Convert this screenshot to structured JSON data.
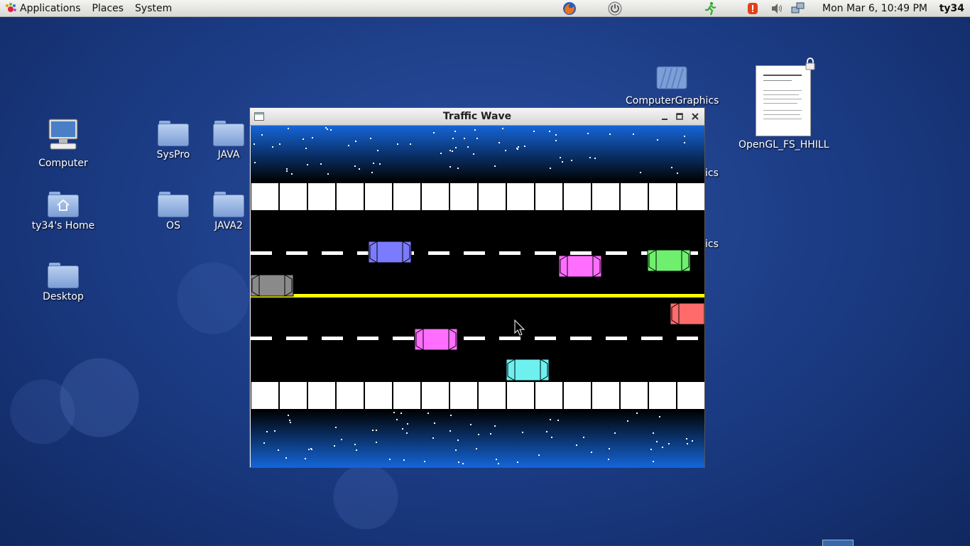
{
  "panel": {
    "menus": [
      "Applications",
      "Places",
      "System"
    ],
    "clock": "Mon Mar  6, 10:49 PM",
    "user": "ty34"
  },
  "desktop": {
    "icons": [
      "Computer",
      "SysPro",
      "JAVA",
      "ty34's Home",
      "OS",
      "JAVA2",
      "Desktop",
      "ComputerGraphics",
      "OpenGL_FS_HHILL"
    ],
    "partial_labels": [
      "ics",
      "ics"
    ]
  },
  "window": {
    "title": "Traffic Wave"
  },
  "icons": {
    "firefox": "firefox-icon",
    "power": "power-icon",
    "runner": "running-man-icon",
    "alert": "alert-icon",
    "volume": "volume-icon",
    "network": "network-icon"
  },
  "colors": {
    "sky_top": "#1565d8",
    "road": "#000000",
    "center_line": "#ffff00",
    "car_blue": "#7b7bff",
    "car_pink": "#ff6eff",
    "car_green": "#6ef06e",
    "car_gray": "#8a8a8a",
    "car_red": "#ff6b6b",
    "car_cyan": "#6ef0f0"
  }
}
